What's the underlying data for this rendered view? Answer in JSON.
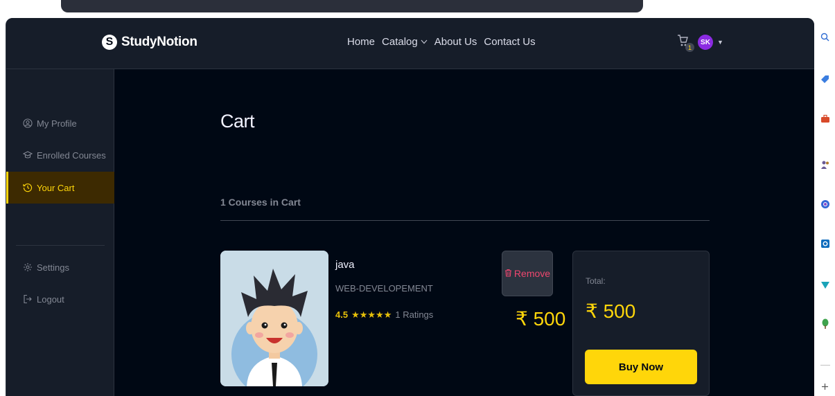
{
  "navbar": {
    "logo_mark": "S",
    "logo_text": "StudyNotion",
    "links": [
      {
        "label": "Home"
      },
      {
        "label": "Catalog"
      },
      {
        "label": "About Us"
      },
      {
        "label": "Contact Us"
      }
    ],
    "cart_count": "1",
    "avatar_initials": "SK"
  },
  "sidebar": {
    "items": [
      {
        "label": "My Profile",
        "icon": "user-circle-icon"
      },
      {
        "label": "Enrolled Courses",
        "icon": "graduation-cap-icon"
      },
      {
        "label": "Your Cart",
        "icon": "history-icon",
        "active": true
      },
      {
        "label": "Settings",
        "icon": "gear-icon"
      },
      {
        "label": "Logout",
        "icon": "logout-icon"
      }
    ]
  },
  "main": {
    "title": "Cart",
    "course_count_label": "1 Courses in Cart",
    "course": {
      "name": "java",
      "category": "WEB-DEVELOPEMENT",
      "rating": "4.5",
      "stars_filled": 5,
      "rating_count": "1 Ratings",
      "remove_label": "Remove",
      "price": "₹ 500"
    },
    "summary": {
      "total_label": "Total:",
      "total_amount": "₹ 500",
      "buy_label": "Buy Now"
    }
  },
  "colors": {
    "accent": "#ffd60a",
    "background": "#000814",
    "panel": "#161d29",
    "danger": "#ef476f",
    "avatar": "#8b2be2"
  }
}
